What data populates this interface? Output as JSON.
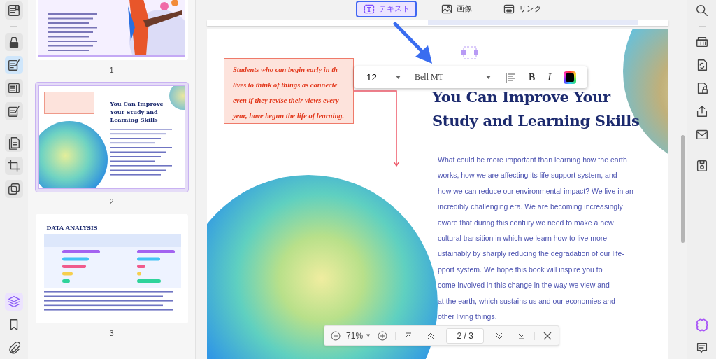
{
  "left_rail": {
    "groups": [
      {
        "items": [
          {
            "kind": "reader",
            "selected": false
          }
        ]
      },
      {
        "items": [
          {
            "kind": "highlight",
            "selected": false
          },
          {
            "kind": "edit",
            "selected": true
          },
          {
            "kind": "form",
            "selected": false
          },
          {
            "kind": "sign",
            "selected": false
          }
        ]
      },
      {
        "items": [
          {
            "kind": "pages",
            "selected": false
          },
          {
            "kind": "crop",
            "selected": false
          },
          {
            "kind": "overlay",
            "selected": false
          }
        ]
      },
      {
        "kind": "bottom",
        "items": [
          {
            "kind": "layers",
            "selected": true
          },
          {
            "kind": "bookmark",
            "selected": false
          },
          {
            "kind": "attachment",
            "selected": false
          }
        ]
      }
    ]
  },
  "thumbnails": [
    {
      "kind": "cover",
      "page_label": "1",
      "selected": false
    },
    {
      "kind": "article",
      "page_label": "2",
      "selected": true,
      "heading": "You Can Improve Your Study and Learning Skills"
    },
    {
      "kind": "chart",
      "page_label": "3",
      "selected": false,
      "heading": "DATA ANALYSIS"
    }
  ],
  "edit_tabs": [
    {
      "kind": "text",
      "label": "テキスト",
      "selected": true
    },
    {
      "kind": "image",
      "label": "画像",
      "selected": false
    },
    {
      "kind": "link",
      "label": "リンク",
      "selected": false
    }
  ],
  "format_toolbar": {
    "font_size": "12",
    "font_name": "Bell MT",
    "bold_label": "B",
    "italic_label": "I"
  },
  "page": {
    "callout_lines": [
      "Students who can begin early in th",
      "lives to think of things as connecte",
      "even if they revise their views every",
      "year, have begun the life of learning."
    ],
    "heading": "You Can Improve Your Study and Learning Skills",
    "body_lines": [
      "What could be more important than learning how the earth",
      "works, how we are affecting its life support system, and",
      "how we can reduce our environmental impact? We live in an",
      "incredibly challenging era. We are becoming increasingly",
      "aware that during this century we need to make a new",
      "cultural transition in which we learn how to live more",
      "ustainably by sharply reducing the degradation of our life-",
      "pport system. We hope this book will inspire you to",
      "come involved in this change in the way we view and",
      "at the earth, which sustains us and our economies and",
      "other living things."
    ]
  },
  "page_nav": {
    "zoom": "71%",
    "page": "2 / 3"
  },
  "right_rail": {
    "groups": [
      {
        "items": [
          {
            "kind": "search"
          }
        ]
      },
      {
        "items": [
          {
            "kind": "ocr"
          },
          {
            "kind": "convert"
          },
          {
            "kind": "protect"
          },
          {
            "kind": "share"
          },
          {
            "kind": "mail"
          }
        ]
      },
      {
        "items": [
          {
            "kind": "save"
          }
        ]
      },
      {
        "kind": "bottom",
        "items": [
          {
            "kind": "ai"
          },
          {
            "kind": "comment"
          }
        ]
      }
    ]
  }
}
